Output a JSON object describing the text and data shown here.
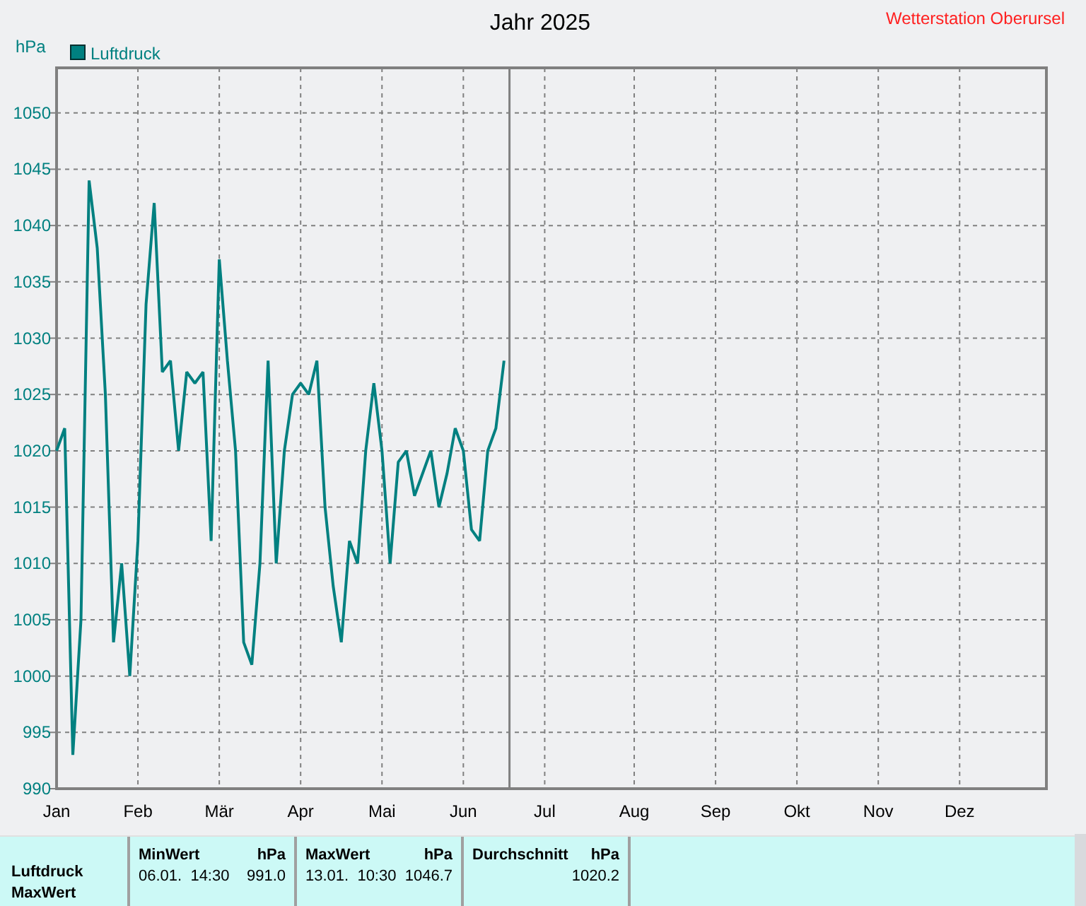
{
  "header": {
    "title": "Jahr 2025",
    "station": "Wetterstation Oberursel",
    "unit": "hPa"
  },
  "chart": {
    "chart_data": {
      "type": "line",
      "grid": true,
      "ylim": [
        990,
        1054
      ],
      "yticks": [
        990,
        995,
        1000,
        1005,
        1010,
        1015,
        1020,
        1025,
        1030,
        1035,
        1040,
        1045,
        1050
      ],
      "categories": [
        "Jan",
        null,
        null,
        null,
        null,
        null,
        null,
        null,
        null,
        null,
        "Feb",
        null,
        null,
        null,
        null,
        null,
        null,
        null,
        null,
        null,
        "Mär",
        null,
        null,
        null,
        null,
        null,
        null,
        null,
        null,
        null,
        "Apr",
        null,
        null,
        null,
        null,
        null,
        null,
        null,
        null,
        null,
        "Mai",
        null,
        null,
        null,
        null,
        null,
        null,
        null,
        null,
        null,
        "Jun",
        null,
        null,
        null,
        null,
        null,
        null,
        null,
        null,
        null,
        "Jul",
        null,
        null,
        null,
        null,
        null,
        null,
        null,
        null,
        null,
        null,
        "Aug",
        null,
        null,
        null,
        null,
        null,
        null,
        null,
        null,
        null,
        "Sep",
        null,
        null,
        null,
        null,
        null,
        null,
        null,
        null,
        null,
        "Okt",
        null,
        null,
        null,
        null,
        null,
        null,
        null,
        null,
        null,
        "Nov",
        null,
        null,
        null,
        null,
        null,
        null,
        null,
        null,
        null,
        "Dez",
        null,
        null,
        null,
        null,
        null,
        null,
        null,
        null,
        null,
        null
      ],
      "series": [
        {
          "name": "Luftdruck",
          "color": "#008080",
          "values": [
            1020,
            1022,
            993,
            1005,
            1044,
            1038,
            1025,
            1003,
            1010,
            1000,
            1012,
            1033,
            1042,
            1027,
            1028,
            1020,
            1027,
            1026,
            1027,
            1012,
            1037,
            1028,
            1020,
            1003,
            1001,
            1010,
            1028,
            1010,
            1020,
            1025,
            1026,
            1025,
            1028,
            1015,
            1008,
            1003,
            1012,
            1010,
            1020,
            1026,
            1020,
            1010,
            1019,
            1020,
            1016,
            1018,
            1020,
            1015,
            1018,
            1022,
            1020,
            1013,
            1012,
            1020,
            1022,
            1028,
            null,
            null,
            null,
            null,
            null,
            null,
            null,
            null,
            null,
            null,
            null,
            null,
            null,
            null,
            null,
            null,
            null,
            null,
            null,
            null,
            null,
            null,
            null,
            null,
            null,
            null,
            null,
            null,
            null,
            null,
            null,
            null,
            null,
            null,
            null,
            null,
            null,
            null,
            null,
            null,
            null,
            null,
            null,
            null,
            null,
            null,
            null,
            null,
            null,
            null,
            null,
            null,
            null,
            null,
            null,
            null,
            null,
            null,
            null,
            null,
            null,
            null,
            null,
            null,
            null,
            null
          ]
        }
      ]
    }
  },
  "summary": {
    "row_labels": [
      "Luftdruck",
      "MaxWert"
    ],
    "columns": [
      {
        "heading": "MinWert",
        "unit": "hPa",
        "time": "06.01.  14:30",
        "value": "991.0"
      },
      {
        "heading": "MaxWert",
        "unit": "hPa",
        "time": "13.01.  10:30",
        "value": "1046.7"
      },
      {
        "heading": "Durchschnitt",
        "unit": "hPa",
        "value": "1020.2"
      }
    ]
  }
}
